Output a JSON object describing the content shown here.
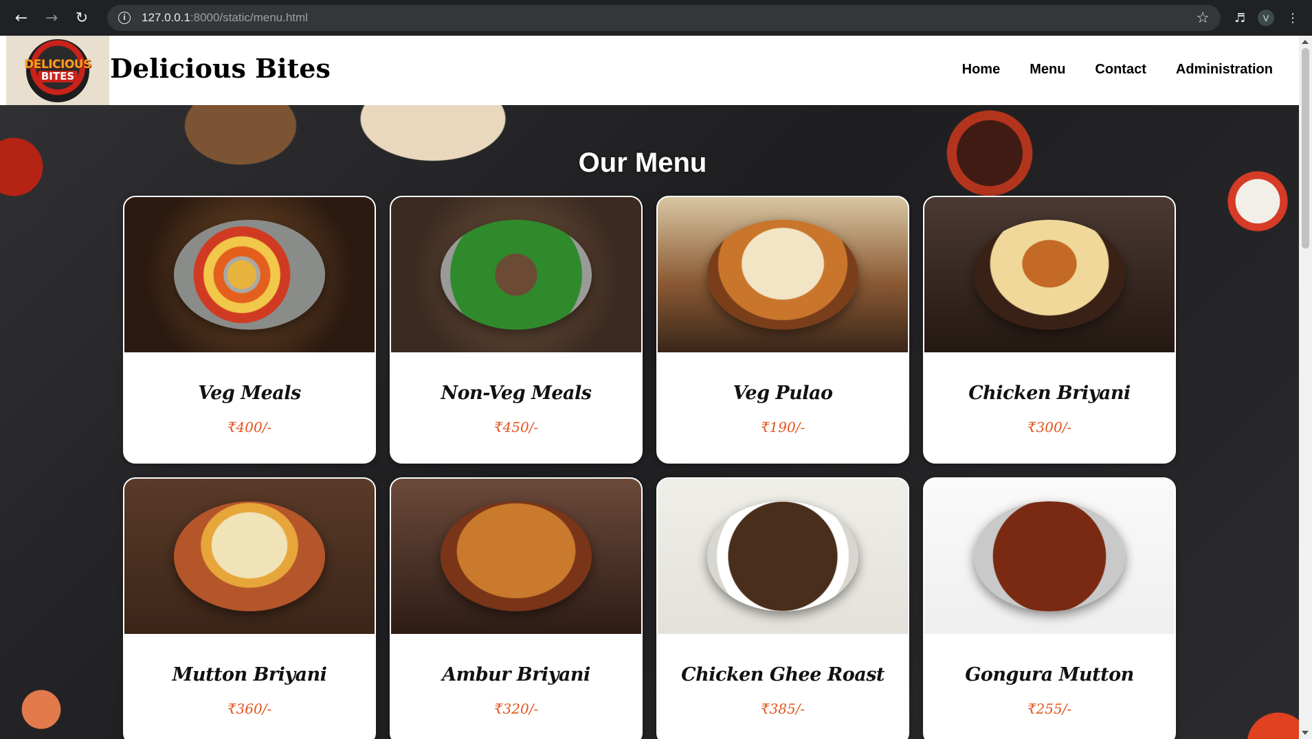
{
  "browser": {
    "url_host": "127.0.0.1",
    "url_path": ":8000/static/menu.html",
    "profile_initial": "V"
  },
  "site": {
    "title": "Delicious Bites",
    "logo_line1": "DELICIOUS",
    "logo_line2": "BITES",
    "nav": [
      "Home",
      "Menu",
      "Contact",
      "Administration"
    ]
  },
  "page": {
    "heading": "Our Menu"
  },
  "menu_items": [
    {
      "name": "Veg Meals",
      "price": "₹400/-"
    },
    {
      "name": "Non-Veg Meals",
      "price": "₹450/-"
    },
    {
      "name": "Veg Pulao",
      "price": "₹190/-"
    },
    {
      "name": "Chicken Briyani",
      "price": "₹300/-"
    },
    {
      "name": "Mutton Briyani",
      "price": "₹360/-"
    },
    {
      "name": "Ambur Briyani",
      "price": "₹320/-"
    },
    {
      "name": "Chicken Ghee Roast",
      "price": "₹385/-"
    },
    {
      "name": "Gongura Mutton",
      "price": "₹255/-"
    }
  ],
  "colors": {
    "price": "#e4531f",
    "header_bg": "#ffffff",
    "browser_bg": "#202124"
  },
  "icons": {
    "back": "back-arrow-icon",
    "forward": "forward-arrow-icon",
    "reload": "reload-icon",
    "info": "info-icon",
    "bookmark": "star-icon",
    "media": "media-queue-icon",
    "menu": "kebab-menu-icon"
  }
}
